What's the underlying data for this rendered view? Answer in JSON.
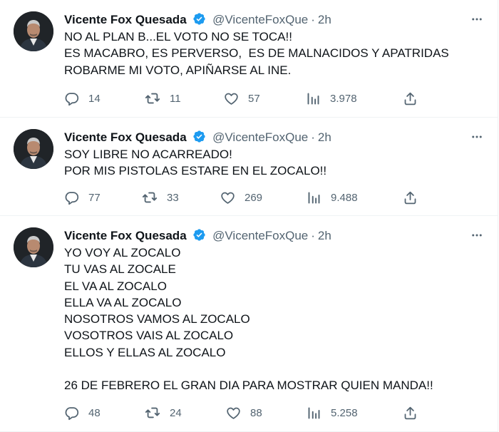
{
  "tweets": [
    {
      "author": {
        "name": "Vicente Fox Quesada",
        "handle": "@VicenteFoxQue",
        "time": "2h"
      },
      "text": "NO AL PLAN B...EL VOTO NO SE TOCA!!\nES MACABRO, ES PERVERSO,  ES DE MALNACIDOS Y APATRIDAS\nROBARME MI VOTO, APIÑARSE AL INE.",
      "stats": {
        "replies": "14",
        "retweets": "11",
        "likes": "57",
        "views": "3.978"
      }
    },
    {
      "author": {
        "name": "Vicente Fox Quesada",
        "handle": "@VicenteFoxQue",
        "time": "2h"
      },
      "text": "SOY LIBRE NO ACARREADO!\nPOR MIS PISTOLAS ESTARE EN EL ZOCALO!!",
      "stats": {
        "replies": "77",
        "retweets": "33",
        "likes": "269",
        "views": "9.488"
      }
    },
    {
      "author": {
        "name": "Vicente Fox Quesada",
        "handle": "@VicenteFoxQue",
        "time": "2h"
      },
      "text": "YO VOY AL ZOCALO\nTU VAS AL ZOCALE\nEL VA AL ZOCALO\nELLA VA AL ZOCALO\nNOSOTROS VAMOS AL ZOCALO\nVOSOTROS VAIS AL ZOCALO\nELLOS Y ELLAS AL ZOCALO\n\n26 DE FEBRERO EL GRAN DIA PARA MOSTRAR QUIEN MANDA!!",
      "stats": {
        "replies": "48",
        "retweets": "24",
        "likes": "88",
        "views": "5.258"
      }
    }
  ],
  "separator": "·",
  "icons": {
    "verified": "verified-badge-icon",
    "more": "more-dots-icon",
    "reply": "reply-icon",
    "retweet": "retweet-icon",
    "like": "heart-icon",
    "views": "views-chart-icon",
    "share": "share-icon"
  },
  "colors": {
    "verified": "#1d9bf0",
    "secondary_text": "#536471",
    "primary_text": "#0f1419",
    "divider": "#eff3f4"
  }
}
